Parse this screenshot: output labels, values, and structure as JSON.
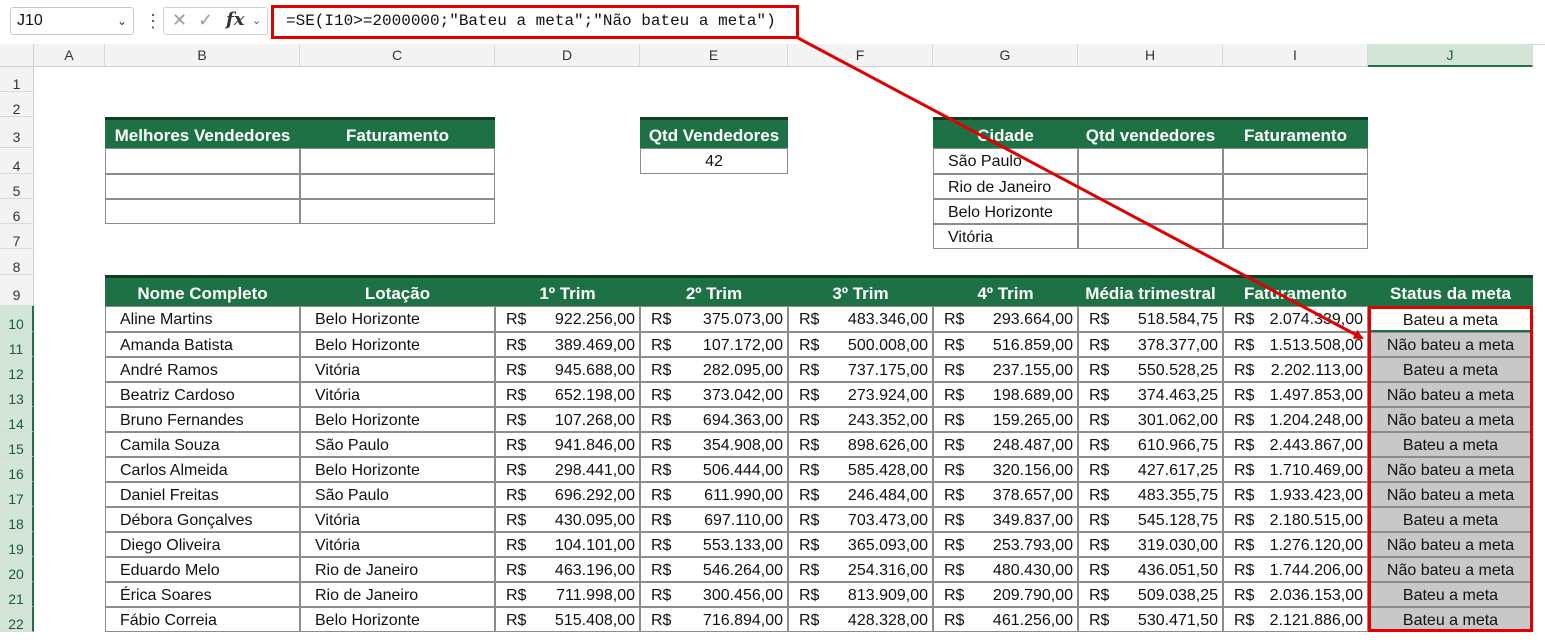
{
  "formula_bar": {
    "name_box": "J10",
    "formula": "=SE(I10>=2000000;\"Bateu a meta\";\"Não bateu a meta\")",
    "fx_label": "fx"
  },
  "columns": [
    "A",
    "B",
    "C",
    "D",
    "E",
    "F",
    "G",
    "H",
    "I",
    "J"
  ],
  "rows": [
    "1",
    "2",
    "3",
    "4",
    "5",
    "6",
    "7",
    "8",
    "9",
    "10",
    "11",
    "12",
    "13",
    "14",
    "15",
    "16",
    "17",
    "18",
    "19",
    "20",
    "21",
    "22"
  ],
  "best_sellers": {
    "headers": [
      "Melhores Vendedores",
      "Faturamento"
    ]
  },
  "qtd_vendedores": {
    "header": "Qtd Vendedores",
    "value": "42"
  },
  "cidades": {
    "headers": [
      "Cidade",
      "Qtd vendedores",
      "Faturamento"
    ],
    "items": [
      "São Paulo",
      "Rio de Janeiro",
      "Belo Horizonte",
      "Vitória"
    ]
  },
  "main_table": {
    "headers": [
      "Nome Completo",
      "Lotação",
      "1º Trim",
      "2º Trim",
      "3º Trim",
      "4º Trim",
      "Média trimestral",
      "Faturamento",
      "Status da meta"
    ],
    "currency": "R$",
    "rows": [
      {
        "nome": "Aline Martins",
        "lotacao": "Belo Horizonte",
        "t1": "922.256,00",
        "t2": "375.073,00",
        "t3": "483.346,00",
        "t4": "293.664,00",
        "media": "518.584,75",
        "fat": "2.074.339,00",
        "status": "Bateu a meta"
      },
      {
        "nome": "Amanda Batista",
        "lotacao": "Belo Horizonte",
        "t1": "389.469,00",
        "t2": "107.172,00",
        "t3": "500.008,00",
        "t4": "516.859,00",
        "media": "378.377,00",
        "fat": "1.513.508,00",
        "status": "Não bateu a meta"
      },
      {
        "nome": "André Ramos",
        "lotacao": "Vitória",
        "t1": "945.688,00",
        "t2": "282.095,00",
        "t3": "737.175,00",
        "t4": "237.155,00",
        "media": "550.528,25",
        "fat": "2.202.113,00",
        "status": "Bateu a meta"
      },
      {
        "nome": "Beatriz Cardoso",
        "lotacao": "Vitória",
        "t1": "652.198,00",
        "t2": "373.042,00",
        "t3": "273.924,00",
        "t4": "198.689,00",
        "media": "374.463,25",
        "fat": "1.497.853,00",
        "status": "Não bateu a meta"
      },
      {
        "nome": "Bruno Fernandes",
        "lotacao": "Belo Horizonte",
        "t1": "107.268,00",
        "t2": "694.363,00",
        "t3": "243.352,00",
        "t4": "159.265,00",
        "media": "301.062,00",
        "fat": "1.204.248,00",
        "status": "Não bateu a meta"
      },
      {
        "nome": "Camila Souza",
        "lotacao": "São Paulo",
        "t1": "941.846,00",
        "t2": "354.908,00",
        "t3": "898.626,00",
        "t4": "248.487,00",
        "media": "610.966,75",
        "fat": "2.443.867,00",
        "status": "Bateu a meta"
      },
      {
        "nome": "Carlos Almeida",
        "lotacao": "Belo Horizonte",
        "t1": "298.441,00",
        "t2": "506.444,00",
        "t3": "585.428,00",
        "t4": "320.156,00",
        "media": "427.617,25",
        "fat": "1.710.469,00",
        "status": "Não bateu a meta"
      },
      {
        "nome": "Daniel Freitas",
        "lotacao": "São Paulo",
        "t1": "696.292,00",
        "t2": "611.990,00",
        "t3": "246.484,00",
        "t4": "378.657,00",
        "media": "483.355,75",
        "fat": "1.933.423,00",
        "status": "Não bateu a meta"
      },
      {
        "nome": "Débora Gonçalves",
        "lotacao": "Vitória",
        "t1": "430.095,00",
        "t2": "697.110,00",
        "t3": "703.473,00",
        "t4": "349.837,00",
        "media": "545.128,75",
        "fat": "2.180.515,00",
        "status": "Bateu a meta"
      },
      {
        "nome": "Diego Oliveira",
        "lotacao": "Vitória",
        "t1": "104.101,00",
        "t2": "553.133,00",
        "t3": "365.093,00",
        "t4": "253.793,00",
        "media": "319.030,00",
        "fat": "1.276.120,00",
        "status": "Não bateu a meta"
      },
      {
        "nome": "Eduardo Melo",
        "lotacao": "Rio de Janeiro",
        "t1": "463.196,00",
        "t2": "546.264,00",
        "t3": "254.316,00",
        "t4": "480.430,00",
        "media": "436.051,50",
        "fat": "1.744.206,00",
        "status": "Não bateu a meta"
      },
      {
        "nome": "Érica Soares",
        "lotacao": "Rio de Janeiro",
        "t1": "711.998,00",
        "t2": "300.456,00",
        "t3": "813.909,00",
        "t4": "209.790,00",
        "media": "509.038,25",
        "fat": "2.036.153,00",
        "status": "Bateu a meta"
      },
      {
        "nome": "Fábio Correia",
        "lotacao": "Belo Horizonte",
        "t1": "515.408,00",
        "t2": "716.894,00",
        "t3": "428.328,00",
        "t4": "461.256,00",
        "media": "530.471,50",
        "fat": "2.121.886,00",
        "status": "Bateu a meta"
      }
    ]
  },
  "annotation_color": "#e00000",
  "header_color": "#1e7145"
}
